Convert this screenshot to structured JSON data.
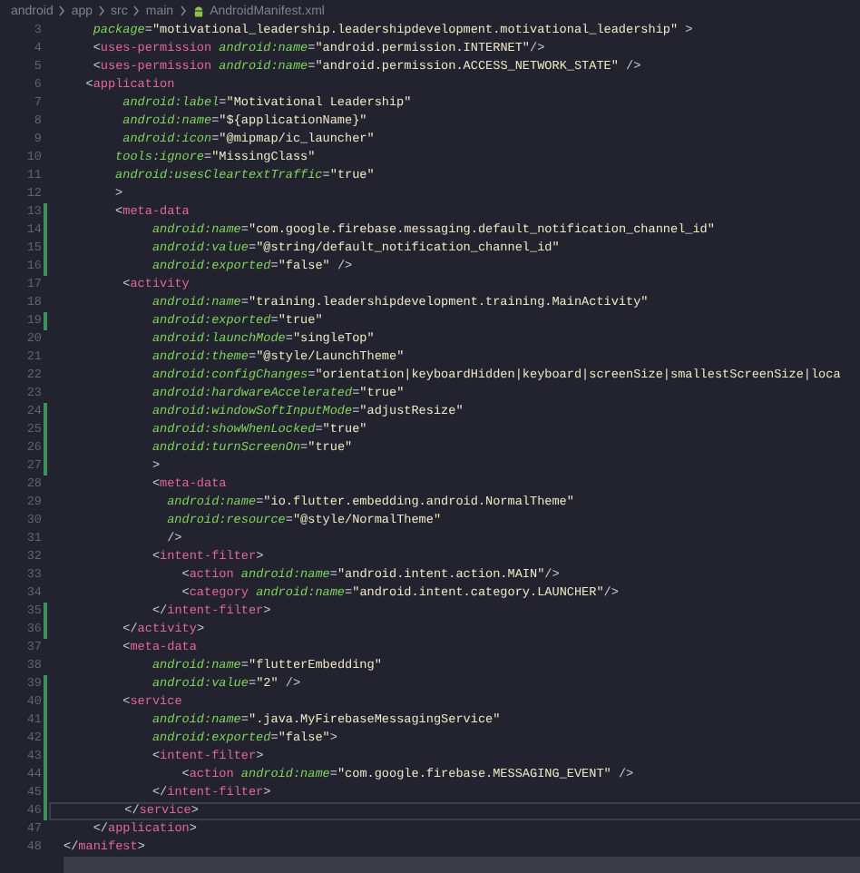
{
  "breadcrumb": [
    {
      "label": "android",
      "kind": "folder"
    },
    {
      "label": "app",
      "kind": "folder"
    },
    {
      "label": "src",
      "kind": "folder"
    },
    {
      "label": "main",
      "kind": "folder"
    },
    {
      "label": "AndroidManifest.xml",
      "kind": "file"
    }
  ],
  "lines": [
    {
      "number": "3",
      "modified": false,
      "current": false,
      "tokens": [
        {
          "kind": "attr",
          "text": "    package"
        },
        {
          "kind": "punct",
          "text": "="
        },
        {
          "kind": "string",
          "text": "\"motivational_leadership.leadershipdevelopment.motivational_leadership\""
        },
        {
          "kind": "punct",
          "text": " >"
        }
      ]
    },
    {
      "number": "4",
      "modified": false,
      "current": false,
      "tokens": [
        {
          "kind": "punct",
          "text": "    <"
        },
        {
          "kind": "tag",
          "text": "uses-permission "
        },
        {
          "kind": "attr",
          "text": "android:name"
        },
        {
          "kind": "punct",
          "text": "="
        },
        {
          "kind": "string",
          "text": "\"android.permission.INTERNET\""
        },
        {
          "kind": "punct",
          "text": "/>"
        }
      ]
    },
    {
      "number": "5",
      "modified": false,
      "current": false,
      "tokens": [
        {
          "kind": "punct",
          "text": "    <"
        },
        {
          "kind": "tag",
          "text": "uses-permission "
        },
        {
          "kind": "attr",
          "text": "android:name"
        },
        {
          "kind": "punct",
          "text": "="
        },
        {
          "kind": "string",
          "text": "\"android.permission.ACCESS_NETWORK_STATE\""
        },
        {
          "kind": "punct",
          "text": " />"
        }
      ]
    },
    {
      "number": "6",
      "modified": false,
      "current": false,
      "tokens": [
        {
          "kind": "punct",
          "text": "   <"
        },
        {
          "kind": "tag",
          "text": "application"
        }
      ]
    },
    {
      "number": "7",
      "modified": false,
      "current": false,
      "tokens": [
        {
          "kind": "attr",
          "text": "        android:label"
        },
        {
          "kind": "punct",
          "text": "="
        },
        {
          "kind": "string",
          "text": "\"Motivational Leadership\""
        }
      ]
    },
    {
      "number": "8",
      "modified": false,
      "current": false,
      "tokens": [
        {
          "kind": "attr",
          "text": "        android:name"
        },
        {
          "kind": "punct",
          "text": "="
        },
        {
          "kind": "string",
          "text": "\"${applicationName}\""
        }
      ]
    },
    {
      "number": "9",
      "modified": false,
      "current": false,
      "tokens": [
        {
          "kind": "attr",
          "text": "        android:icon"
        },
        {
          "kind": "punct",
          "text": "="
        },
        {
          "kind": "string",
          "text": "\"@mipmap/ic_launcher\""
        }
      ]
    },
    {
      "number": "10",
      "modified": false,
      "current": false,
      "tokens": [
        {
          "kind": "attr",
          "text": "       tools:ignore"
        },
        {
          "kind": "punct",
          "text": "="
        },
        {
          "kind": "string",
          "text": "\"MissingClass\""
        }
      ]
    },
    {
      "number": "11",
      "modified": false,
      "current": false,
      "tokens": [
        {
          "kind": "attr",
          "text": "       android:usesCleartextTraffic"
        },
        {
          "kind": "punct",
          "text": "="
        },
        {
          "kind": "string",
          "text": "\"true\""
        }
      ]
    },
    {
      "number": "12",
      "modified": false,
      "current": false,
      "tokens": [
        {
          "kind": "punct",
          "text": "       >"
        }
      ]
    },
    {
      "number": "13",
      "modified": true,
      "current": false,
      "tokens": [
        {
          "kind": "punct",
          "text": "       <"
        },
        {
          "kind": "tag",
          "text": "meta-data"
        }
      ]
    },
    {
      "number": "14",
      "modified": true,
      "current": false,
      "tokens": [
        {
          "kind": "attr",
          "text": "            android:name"
        },
        {
          "kind": "punct",
          "text": "="
        },
        {
          "kind": "string",
          "text": "\"com.google.firebase.messaging.default_notification_channel_id\""
        }
      ]
    },
    {
      "number": "15",
      "modified": true,
      "current": false,
      "tokens": [
        {
          "kind": "attr",
          "text": "            android:value"
        },
        {
          "kind": "punct",
          "text": "="
        },
        {
          "kind": "string",
          "text": "\"@string/default_notification_channel_id\""
        }
      ]
    },
    {
      "number": "16",
      "modified": true,
      "current": false,
      "tokens": [
        {
          "kind": "attr",
          "text": "            android:exported"
        },
        {
          "kind": "punct",
          "text": "="
        },
        {
          "kind": "string",
          "text": "\"false\""
        },
        {
          "kind": "punct",
          "text": " />"
        }
      ]
    },
    {
      "number": "17",
      "modified": false,
      "current": false,
      "tokens": [
        {
          "kind": "punct",
          "text": "        <"
        },
        {
          "kind": "tag",
          "text": "activity"
        }
      ]
    },
    {
      "number": "18",
      "modified": false,
      "current": false,
      "tokens": [
        {
          "kind": "attr",
          "text": "            android:name"
        },
        {
          "kind": "punct",
          "text": "="
        },
        {
          "kind": "string",
          "text": "\"training.leadershipdevelopment.training.MainActivity\""
        }
      ]
    },
    {
      "number": "19",
      "modified": true,
      "current": false,
      "tokens": [
        {
          "kind": "attr",
          "text": "            android:exported"
        },
        {
          "kind": "punct",
          "text": "="
        },
        {
          "kind": "string",
          "text": "\"true\""
        }
      ]
    },
    {
      "number": "20",
      "modified": false,
      "current": false,
      "tokens": [
        {
          "kind": "attr",
          "text": "            android:launchMode"
        },
        {
          "kind": "punct",
          "text": "="
        },
        {
          "kind": "string",
          "text": "\"singleTop\""
        }
      ]
    },
    {
      "number": "21",
      "modified": false,
      "current": false,
      "tokens": [
        {
          "kind": "attr",
          "text": "            android:theme"
        },
        {
          "kind": "punct",
          "text": "="
        },
        {
          "kind": "string",
          "text": "\"@style/LaunchTheme\""
        }
      ]
    },
    {
      "number": "22",
      "modified": false,
      "current": false,
      "tokens": [
        {
          "kind": "attr",
          "text": "            android:configChanges"
        },
        {
          "kind": "punct",
          "text": "="
        },
        {
          "kind": "string",
          "text": "\"orientation|keyboardHidden|keyboard|screenSize|smallestScreenSize|loca"
        }
      ]
    },
    {
      "number": "23",
      "modified": false,
      "current": false,
      "tokens": [
        {
          "kind": "attr",
          "text": "            android:hardwareAccelerated"
        },
        {
          "kind": "punct",
          "text": "="
        },
        {
          "kind": "string",
          "text": "\"true\""
        }
      ]
    },
    {
      "number": "24",
      "modified": true,
      "current": false,
      "tokens": [
        {
          "kind": "attr",
          "text": "            android:windowSoftInputMode"
        },
        {
          "kind": "punct",
          "text": "="
        },
        {
          "kind": "string",
          "text": "\"adjustResize\""
        }
      ]
    },
    {
      "number": "25",
      "modified": true,
      "current": false,
      "tokens": [
        {
          "kind": "attr",
          "text": "            android:showWhenLocked"
        },
        {
          "kind": "punct",
          "text": "="
        },
        {
          "kind": "string",
          "text": "\"true\""
        }
      ]
    },
    {
      "number": "26",
      "modified": true,
      "current": false,
      "tokens": [
        {
          "kind": "attr",
          "text": "            android:turnScreenOn"
        },
        {
          "kind": "punct",
          "text": "="
        },
        {
          "kind": "string",
          "text": "\"true\""
        }
      ]
    },
    {
      "number": "27",
      "modified": true,
      "current": false,
      "tokens": [
        {
          "kind": "punct",
          "text": "            >"
        }
      ]
    },
    {
      "number": "28",
      "modified": false,
      "current": false,
      "tokens": [
        {
          "kind": "punct",
          "text": "            <"
        },
        {
          "kind": "tag",
          "text": "meta-data"
        }
      ]
    },
    {
      "number": "29",
      "modified": false,
      "current": false,
      "tokens": [
        {
          "kind": "attr",
          "text": "              android:name"
        },
        {
          "kind": "punct",
          "text": "="
        },
        {
          "kind": "string",
          "text": "\"io.flutter.embedding.android.NormalTheme\""
        }
      ]
    },
    {
      "number": "30",
      "modified": false,
      "current": false,
      "tokens": [
        {
          "kind": "attr",
          "text": "              android:resource"
        },
        {
          "kind": "punct",
          "text": "="
        },
        {
          "kind": "string",
          "text": "\"@style/NormalTheme\""
        }
      ]
    },
    {
      "number": "31",
      "modified": false,
      "current": false,
      "tokens": [
        {
          "kind": "punct",
          "text": "              />"
        }
      ]
    },
    {
      "number": "32",
      "modified": false,
      "current": false,
      "tokens": [
        {
          "kind": "punct",
          "text": "            <"
        },
        {
          "kind": "tag",
          "text": "intent-filter"
        },
        {
          "kind": "punct",
          "text": ">"
        }
      ]
    },
    {
      "number": "33",
      "modified": false,
      "current": false,
      "tokens": [
        {
          "kind": "punct",
          "text": "                <"
        },
        {
          "kind": "tag",
          "text": "action "
        },
        {
          "kind": "attr",
          "text": "android:name"
        },
        {
          "kind": "punct",
          "text": "="
        },
        {
          "kind": "string",
          "text": "\"android.intent.action.MAIN\""
        },
        {
          "kind": "punct",
          "text": "/>"
        }
      ]
    },
    {
      "number": "34",
      "modified": false,
      "current": false,
      "tokens": [
        {
          "kind": "punct",
          "text": "                <"
        },
        {
          "kind": "tag",
          "text": "category "
        },
        {
          "kind": "attr",
          "text": "android:name"
        },
        {
          "kind": "punct",
          "text": "="
        },
        {
          "kind": "string",
          "text": "\"android.intent.category.LAUNCHER\""
        },
        {
          "kind": "punct",
          "text": "/>"
        }
      ]
    },
    {
      "number": "35",
      "modified": true,
      "current": false,
      "tokens": [
        {
          "kind": "punct",
          "text": "            </"
        },
        {
          "kind": "tag",
          "text": "intent-filter"
        },
        {
          "kind": "punct",
          "text": ">"
        }
      ]
    },
    {
      "number": "36",
      "modified": true,
      "current": false,
      "tokens": [
        {
          "kind": "punct",
          "text": "        </"
        },
        {
          "kind": "tag",
          "text": "activity"
        },
        {
          "kind": "punct",
          "text": ">"
        }
      ]
    },
    {
      "number": "37",
      "modified": false,
      "current": false,
      "tokens": [
        {
          "kind": "punct",
          "text": "        <"
        },
        {
          "kind": "tag",
          "text": "meta-data"
        }
      ]
    },
    {
      "number": "38",
      "modified": false,
      "current": false,
      "tokens": [
        {
          "kind": "attr",
          "text": "            android:name"
        },
        {
          "kind": "punct",
          "text": "="
        },
        {
          "kind": "string",
          "text": "\"flutterEmbedding\""
        }
      ]
    },
    {
      "number": "39",
      "modified": true,
      "current": false,
      "tokens": [
        {
          "kind": "attr",
          "text": "            android:value"
        },
        {
          "kind": "punct",
          "text": "="
        },
        {
          "kind": "string",
          "text": "\"2\""
        },
        {
          "kind": "punct",
          "text": " />"
        }
      ]
    },
    {
      "number": "40",
      "modified": true,
      "current": false,
      "tokens": [
        {
          "kind": "punct",
          "text": "        <"
        },
        {
          "kind": "tag",
          "text": "service"
        }
      ]
    },
    {
      "number": "41",
      "modified": true,
      "current": false,
      "tokens": [
        {
          "kind": "attr",
          "text": "            android:name"
        },
        {
          "kind": "punct",
          "text": "="
        },
        {
          "kind": "string",
          "text": "\".java.MyFirebaseMessagingService\""
        }
      ]
    },
    {
      "number": "42",
      "modified": true,
      "current": false,
      "tokens": [
        {
          "kind": "attr",
          "text": "            android:exported"
        },
        {
          "kind": "punct",
          "text": "="
        },
        {
          "kind": "string",
          "text": "\"false\""
        },
        {
          "kind": "punct",
          "text": ">"
        }
      ]
    },
    {
      "number": "43",
      "modified": true,
      "current": false,
      "tokens": [
        {
          "kind": "punct",
          "text": "            <"
        },
        {
          "kind": "tag",
          "text": "intent-filter"
        },
        {
          "kind": "punct",
          "text": ">"
        }
      ]
    },
    {
      "number": "44",
      "modified": true,
      "current": false,
      "tokens": [
        {
          "kind": "punct",
          "text": "                <"
        },
        {
          "kind": "tag",
          "text": "action "
        },
        {
          "kind": "attr",
          "text": "android:name"
        },
        {
          "kind": "punct",
          "text": "="
        },
        {
          "kind": "string",
          "text": "\"com.google.firebase.MESSAGING_EVENT\""
        },
        {
          "kind": "punct",
          "text": " />"
        }
      ]
    },
    {
      "number": "45",
      "modified": true,
      "current": false,
      "tokens": [
        {
          "kind": "punct",
          "text": "            </"
        },
        {
          "kind": "tag",
          "text": "intent-filter"
        },
        {
          "kind": "punct",
          "text": ">"
        }
      ]
    },
    {
      "number": "46",
      "modified": true,
      "current": true,
      "tokens": [
        {
          "kind": "punct",
          "text": "        </"
        },
        {
          "kind": "tag",
          "text": "service"
        },
        {
          "kind": "punct",
          "text": ">"
        }
      ]
    },
    {
      "number": "47",
      "modified": false,
      "current": false,
      "tokens": [
        {
          "kind": "punct",
          "text": "    </"
        },
        {
          "kind": "tag",
          "text": "application"
        },
        {
          "kind": "punct",
          "text": ">"
        }
      ]
    },
    {
      "number": "48",
      "modified": false,
      "current": false,
      "tokens": [
        {
          "kind": "punct",
          "text": "</"
        },
        {
          "kind": "tag",
          "text": "manifest"
        },
        {
          "kind": "punct",
          "text": ">"
        }
      ]
    }
  ]
}
